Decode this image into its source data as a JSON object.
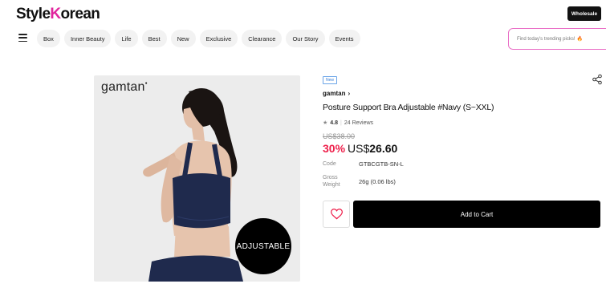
{
  "header": {
    "logo_prefix": "Style",
    "logo_k": "K",
    "logo_suffix": "orean",
    "wholesale_label": "Wholesale"
  },
  "nav": {
    "items": [
      "Box",
      "Inner Beauty",
      "Life",
      "Best",
      "New",
      "Exclusive",
      "Clearance",
      "Our Story",
      "Events"
    ]
  },
  "search": {
    "placeholder": "Find today's trending picks!",
    "icon": "flame-icon"
  },
  "image": {
    "brand": "gamtan",
    "badge": "ADJUSTABLE"
  },
  "product": {
    "badge": "New",
    "brand": "gamtan",
    "brand_chevron": "›",
    "title": "Posture Support Bra Adjustable #Navy (S~XXL)",
    "rating": "4.8",
    "reviews": "24 Reviews",
    "original_price": "US$38.00",
    "discount": "30%",
    "currency": "US$",
    "price": "26.60",
    "code_label": "Code",
    "code_value": "GTBCGTB-SN-L",
    "weight_label_1": "Gross",
    "weight_label_2": "Weight",
    "weight_value": "26g (0.06 lbs)",
    "add_to_cart": "Add to Cart"
  },
  "colors": {
    "accent_pink": "#e0249d",
    "discount_red": "#ee1f4a",
    "navy": "#1f2a4d"
  }
}
